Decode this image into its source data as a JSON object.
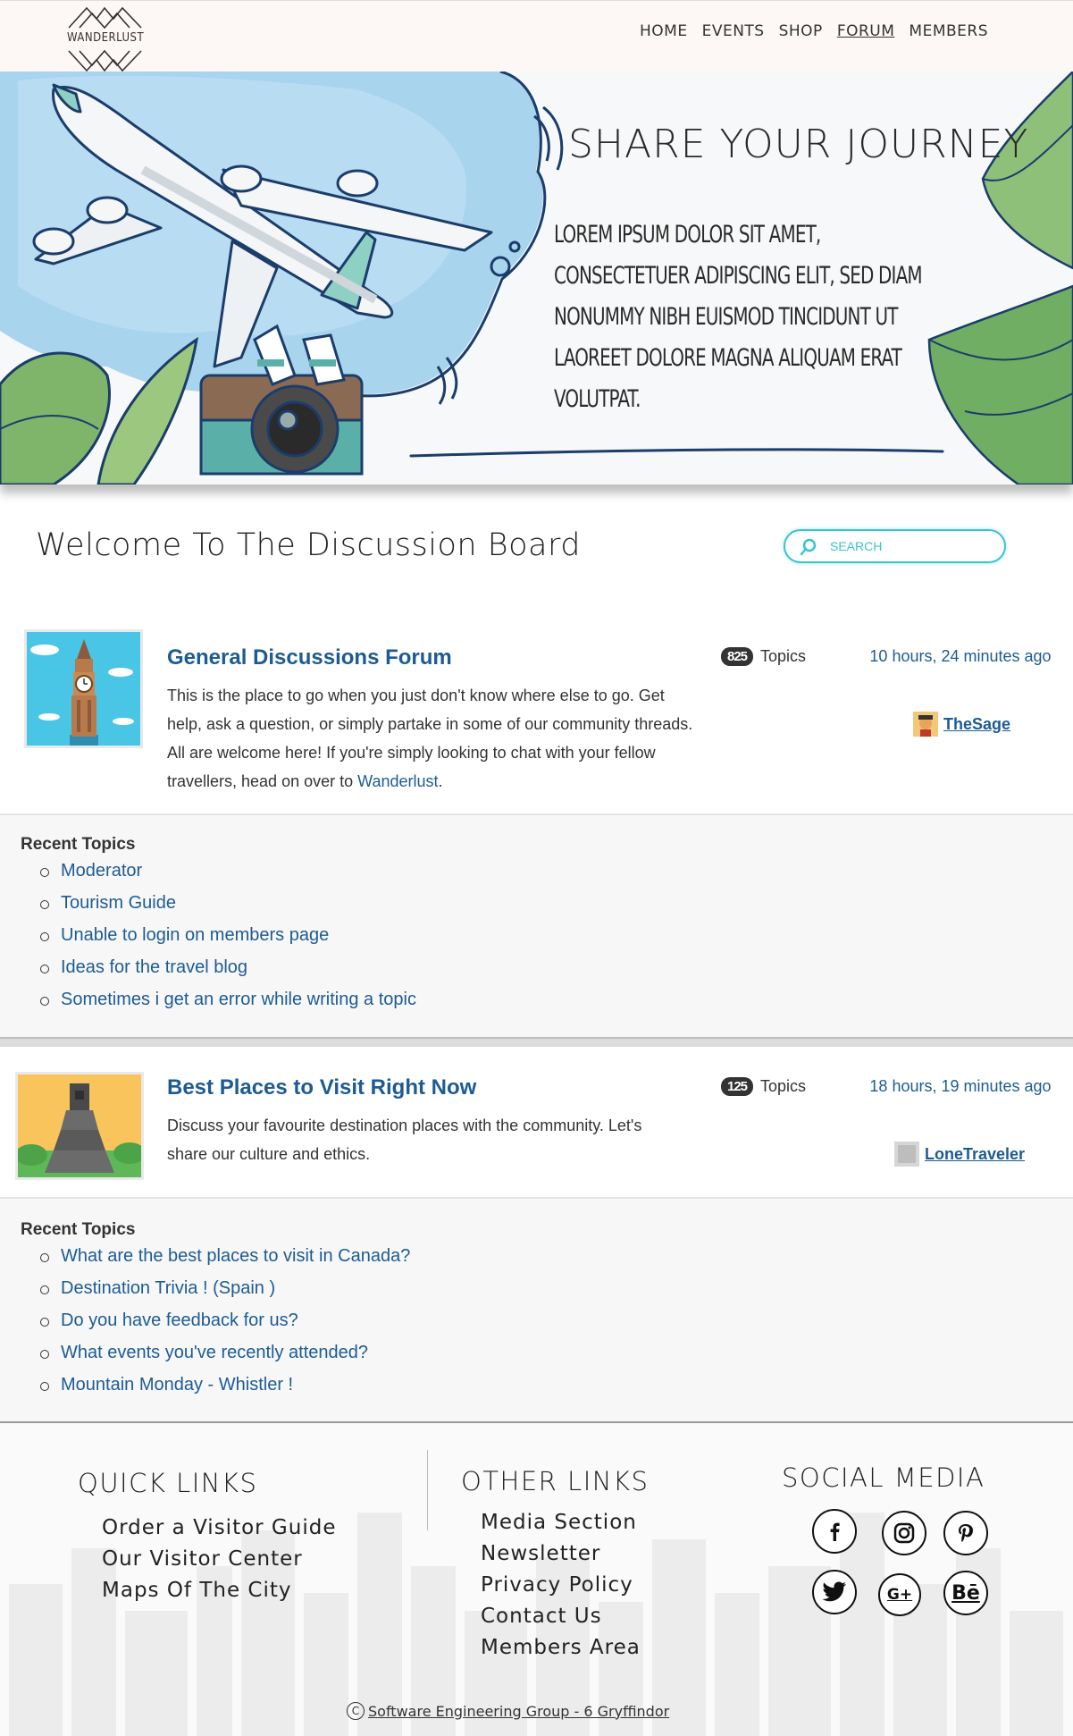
{
  "brand": {
    "logo_text": "WANDERLUST"
  },
  "nav": {
    "items": [
      {
        "label": "HOME",
        "active": false
      },
      {
        "label": "EVENTS",
        "active": false
      },
      {
        "label": "SHOP",
        "active": false
      },
      {
        "label": "FORUM",
        "active": true
      },
      {
        "label": "MEMBERS",
        "active": false
      }
    ]
  },
  "hero": {
    "title": "SHARE YOUR JOURNEY",
    "text": "Lorem ipsum dolor sit amet, consectetuer adipiscing elit, sed diam nonummy nibh euismod tincidunt ut laoreet dolore magna aliquam erat volutpat."
  },
  "welcome": {
    "title": "Welcome To The Discussion Board",
    "search_placeholder": "SEARCH"
  },
  "forums": [
    {
      "title": "General Discussions Forum",
      "description": "This is the place to go when you just don't know where else to go. Get help, ask a question, or simply partake in some of our community threads. All are welcome here! If you're simply looking to chat with your fellow travellers, head on over to",
      "description_link": "Wanderlust",
      "description_end": ".",
      "topic_count": "825",
      "topics_label": "Topics",
      "last_post_time": "10 hours, 24 minutes ago",
      "last_post_user": "TheSage",
      "recent_title": "Recent Topics",
      "recent_topics": [
        "Moderator",
        "Tourism Guide",
        "Unable to login on members page",
        "Ideas for the travel blog",
        "Sometimes i get an error while writing a topic"
      ]
    },
    {
      "title": "Best Places to Visit Right Now",
      "description": "Discuss your favourite destination places with the community. Let's share our culture and ethics.",
      "topic_count": "125",
      "topics_label": "Topics",
      "last_post_time": "18 hours, 19 minutes ago",
      "last_post_user": "LoneTraveler",
      "recent_title": "Recent Topics",
      "recent_topics": [
        "What are the best places to visit in Canada?",
        "Destination Trivia ! (Spain )",
        "Do you have feedback for us?",
        "What events you've recently attended?",
        "Mountain Monday - Whistler !"
      ]
    }
  ],
  "footer": {
    "quick_links": {
      "title": "QUICK LINKS",
      "items": [
        "Order a Visitor Guide",
        "Our Visitor Center",
        "Maps Of The City"
      ]
    },
    "other_links": {
      "title": "OTHER LINKS",
      "items": [
        "Media Section",
        "Newsletter",
        "Privacy Policy",
        "Contact Us",
        "Members Area"
      ]
    },
    "social": {
      "title": "SOCIAL MEDIA",
      "icons": [
        "facebook-icon",
        "instagram-icon",
        "pinterest-icon",
        "twitter-icon",
        "google-plus-icon",
        "behance-icon"
      ]
    },
    "copyright_symbol": "C",
    "copyright": "Software Engineering Group - 6 Gryffindor"
  },
  "colors": {
    "link": "#1d5b94",
    "search_accent": "#35c4d2",
    "badge": "#333333"
  }
}
